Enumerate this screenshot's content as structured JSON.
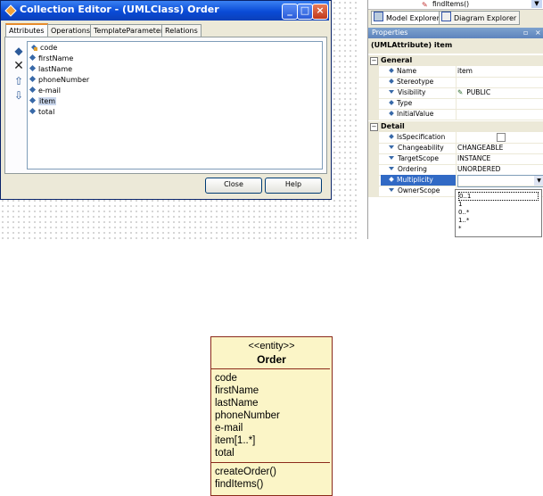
{
  "dialog": {
    "title": "Collection Editor - (UMLClass) Order",
    "tabs": [
      "Attributes",
      "Operations",
      "TemplateParameters",
      "Relations"
    ],
    "side_buttons": [
      "add-icon",
      "delete-icon",
      "move-up-icon",
      "move-down-icon"
    ],
    "attributes": [
      "code",
      "firstName",
      "lastName",
      "phoneNumber",
      "e-mail",
      "item",
      "total"
    ],
    "class_label": "code",
    "selected_attribute": "item",
    "close_label": "Close",
    "help_label": "Help"
  },
  "explorer": {
    "top_item": "findItems()",
    "tabs": [
      "Model Explorer",
      "Diagram Explorer"
    ]
  },
  "properties": {
    "header": "Properties",
    "object_title": "(UMLAttribute) item",
    "general_label": "General",
    "detail_label": "Detail",
    "general": [
      {
        "name": "Name",
        "value": "item"
      },
      {
        "name": "Stereotype",
        "value": ""
      },
      {
        "name": "Visibility",
        "value": "PUBLIC"
      },
      {
        "name": "Type",
        "value": ""
      },
      {
        "name": "InitialValue",
        "value": ""
      }
    ],
    "detail": [
      {
        "name": "IsSpecification",
        "value": ""
      },
      {
        "name": "Changeability",
        "value": "CHANGEABLE"
      },
      {
        "name": "TargetScope",
        "value": "INSTANCE"
      },
      {
        "name": "Ordering",
        "value": "UNORDERED"
      },
      {
        "name": "Multiplicity",
        "value": ""
      },
      {
        "name": "OwnerScope",
        "value": ""
      }
    ],
    "multiplicity_options": [
      "0..1",
      "1",
      "0..*",
      "1..*",
      "*"
    ]
  },
  "uml_class": {
    "stereotype": "<<entity>>",
    "name": "Order",
    "attributes": [
      "code",
      "firstName",
      "lastName",
      "phoneNumber",
      "e-mail",
      "item[1..*]",
      "total"
    ],
    "operations": [
      "createOrder()",
      "findItems()"
    ]
  }
}
